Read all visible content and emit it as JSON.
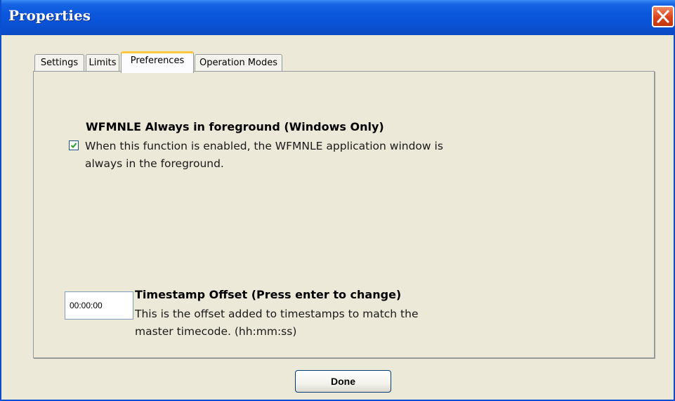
{
  "window": {
    "title": "Properties"
  },
  "tabs": [
    {
      "label": "Settings",
      "active": false
    },
    {
      "label": "Limits",
      "active": false
    },
    {
      "label": "Preferences",
      "active": true
    },
    {
      "label": "Operation Modes",
      "active": false
    }
  ],
  "preferences": {
    "foreground": {
      "heading": "WFMNLE Always in foreground (Windows Only)",
      "description_line1": "When this function is enabled, the WFMNLE application window is",
      "description_line2": "always in the foreground.",
      "checked": true
    },
    "timestamp": {
      "value": "00:00:00",
      "heading": "Timestamp Offset (Press enter to change)",
      "description_line1": "This is the offset added to timestamps to match the",
      "description_line2": "master timecode. (hh:mm:ss)"
    }
  },
  "buttons": {
    "done_label": "Done"
  },
  "colors": {
    "titlebar": "#0a52d6",
    "close_button": "#d9431c",
    "active_tab_highlight": "#ffc83c",
    "checkmark": "#21a121",
    "window_background": "#ece9d8"
  },
  "icons": {
    "close": "close-icon",
    "check": "checkmark-icon"
  }
}
